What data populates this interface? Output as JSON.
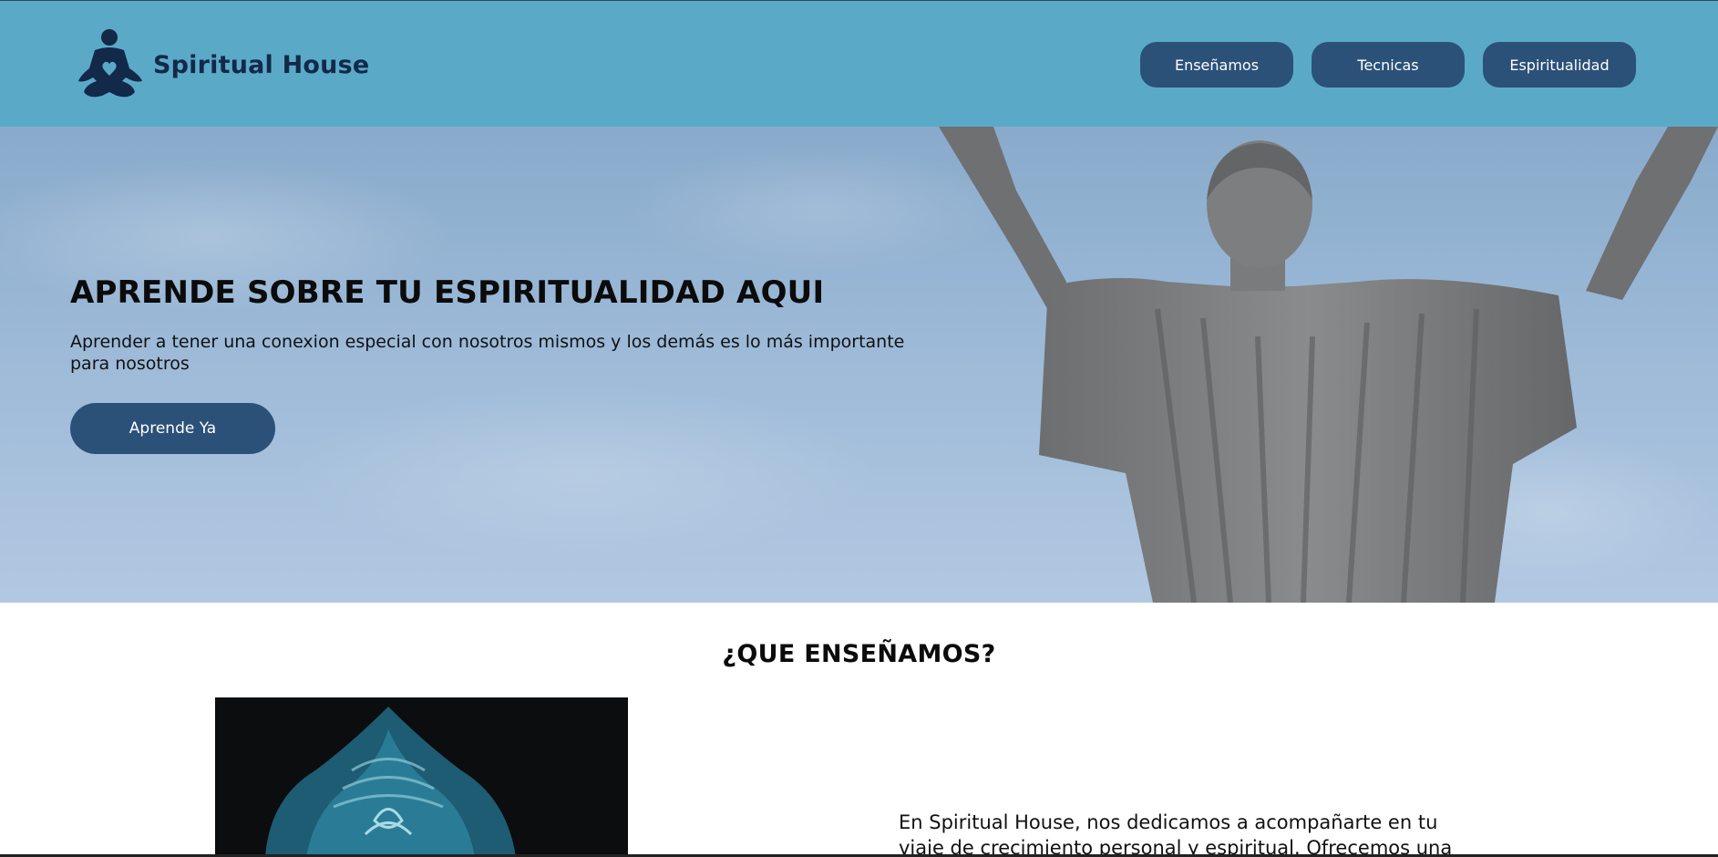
{
  "header": {
    "brand": "Spiritual House",
    "logo_icon": "meditation-heart-icon",
    "nav": [
      {
        "label": "Enseñamos"
      },
      {
        "label": "Tecnicas"
      },
      {
        "label": "Espiritualidad"
      }
    ]
  },
  "hero": {
    "title": "APRENDE SOBRE TU ESPIRITUALIDAD AQUI",
    "subtitle": "Aprender a tener una conexion especial con nosotros mismos y los demás es lo más importante para nosotros",
    "cta_label": "Aprende Ya"
  },
  "teach": {
    "title": "¿QUE ENSEÑAMOS?",
    "text": "En Spiritual House, nos dedicamos a acompañarte en tu viaje de crecimiento personal y espiritual. Ofrecemos una"
  },
  "colors": {
    "header_bg": "#5aaac7",
    "button_bg": "#2b5178",
    "brand_text": "#13294a"
  }
}
